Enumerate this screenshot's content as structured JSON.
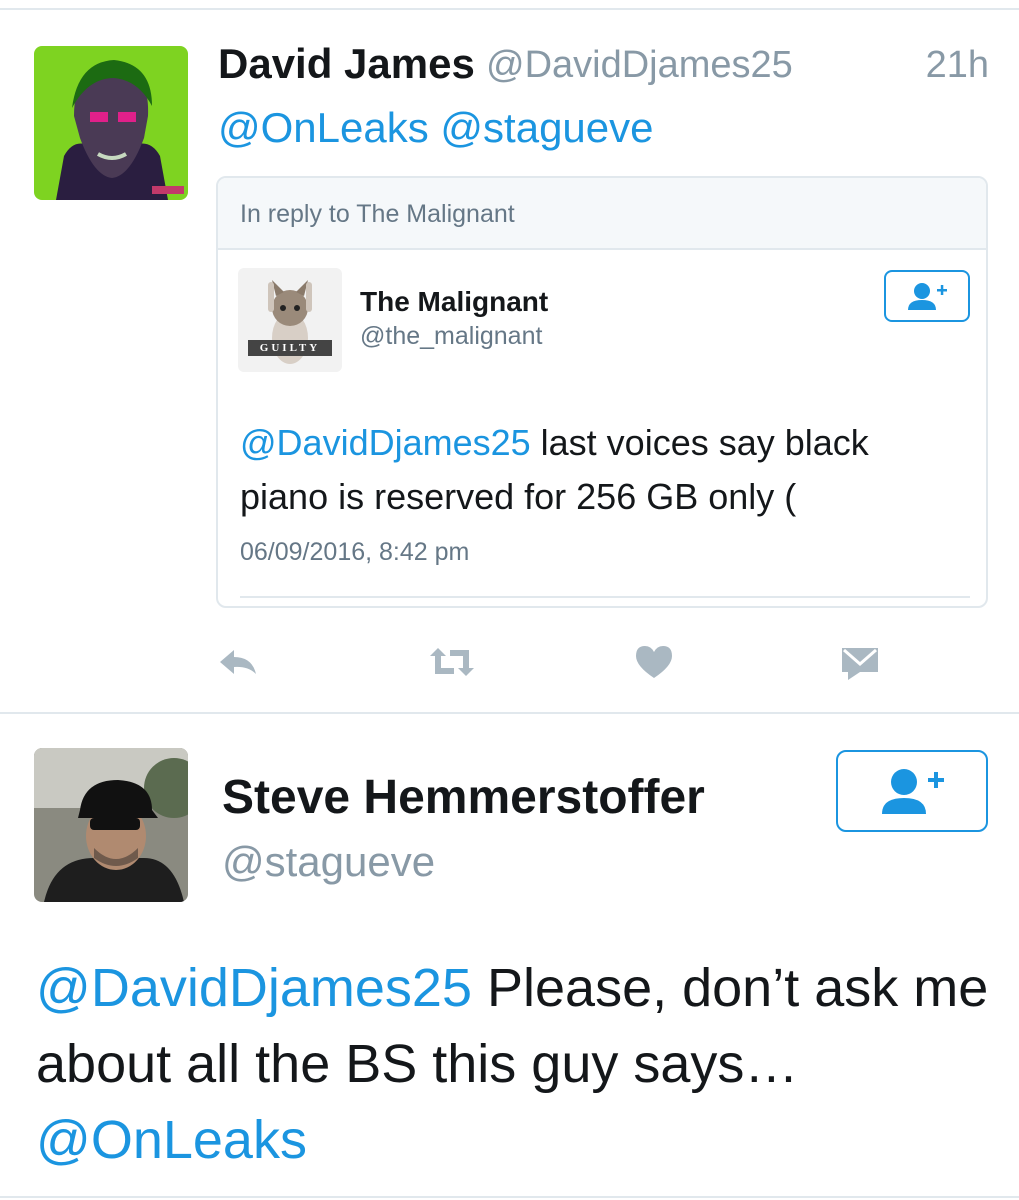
{
  "tweet1": {
    "author_name": "David James",
    "author_handle": "@DavidDjames25",
    "time": "21h",
    "mentions": "@OnLeaks @stagueve",
    "avatar_icon": "joker-avatar",
    "quoted": {
      "header": "In reply to The Malignant",
      "name": "The Malignant",
      "handle": "@the_malignant",
      "avatar_caption": "GUILTY",
      "mention": "@DavidDjames25",
      "text": " last voices say black piano is reserved for 256 GB only (",
      "date": "06/09/2016, 8:42 pm"
    },
    "actions": [
      "reply-icon",
      "retweet-icon",
      "like-icon",
      "direct-message-icon"
    ]
  },
  "tweet2": {
    "author_name": "Steve Hemmerstoffer",
    "author_handle": "@stagueve",
    "mention1": "@DavidDjames25",
    "text": " Please, don’t ask me about all the BS this guy says… ",
    "mention2": "@OnLeaks"
  },
  "colors": {
    "link": "#1b95e0",
    "secondary_text": "#8899a6",
    "border": "#e1e8ed",
    "icon": "#aab8c2",
    "avatar_green": "#7ed321"
  }
}
